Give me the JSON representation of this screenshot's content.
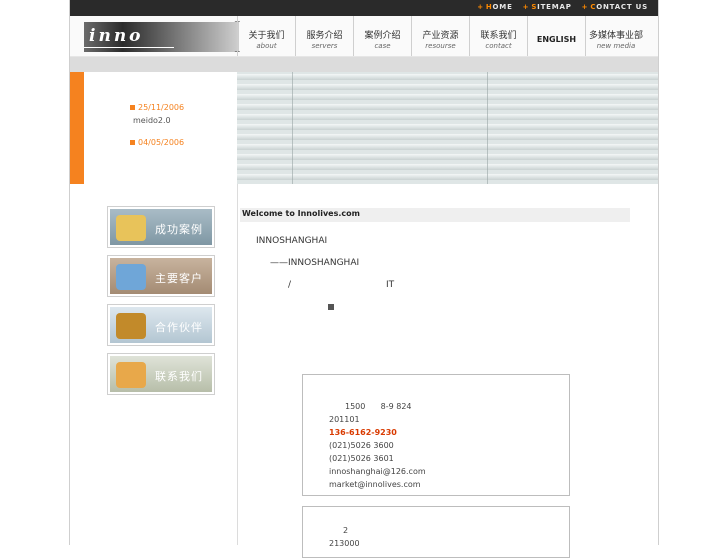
{
  "top_links": [
    {
      "cap": "H",
      "rest": "OME"
    },
    {
      "cap": "S",
      "rest": "ITEMAP"
    },
    {
      "cap": "C",
      "rest": "ONTACT US"
    }
  ],
  "logo": {
    "text": "inno"
  },
  "nav": [
    {
      "cn": "关于我们",
      "en": "about"
    },
    {
      "cn": "服务介绍",
      "en": "servers"
    },
    {
      "cn": "案例介绍",
      "en": "case"
    },
    {
      "cn": "产业资源",
      "en": "resourse"
    },
    {
      "cn": "联系我们",
      "en": "contact"
    },
    {
      "cn": "",
      "en": "ENGLISH"
    },
    {
      "cn": "多媒体事业部",
      "en": "new media"
    }
  ],
  "news": [
    {
      "date": "25/11/2006",
      "title": "meido2.0"
    },
    {
      "date": "04/05/2006",
      "title": ""
    }
  ],
  "side_buttons": [
    {
      "label": "成功案例",
      "color": "#8fa7b3",
      "icon_color": "#e8c35a"
    },
    {
      "label": "主要客户",
      "color": "#b59d86",
      "icon_color": "#6fa6d8"
    },
    {
      "label": "合作伙伴",
      "color": "#c3d3dd",
      "icon_color": "#c28a2a"
    },
    {
      "label": "联系我们",
      "color": "#c7cdbd",
      "icon_color": "#e8a84a"
    }
  ],
  "content": {
    "welcome": "Welcome to Innolives.com",
    "line1": "INNOSHANGHAI",
    "line2": "——INNOSHANGHAI",
    "line3a": "/",
    "line3b": "IT"
  },
  "contact": {
    "address": "1500      8-9 824",
    "postcode": "201101",
    "mobile": "136-6162-9230",
    "tel": "(021)5026 3600",
    "fax": "(021)5026 3601",
    "email1": "innoshanghai@126.com",
    "email2": "market@innolives.com"
  },
  "contact2": {
    "line1": "2",
    "line2": "213000"
  },
  "colors": {
    "accent": "#f5821f",
    "topbar": "#2a2a2a",
    "phone": "#d93a00"
  }
}
